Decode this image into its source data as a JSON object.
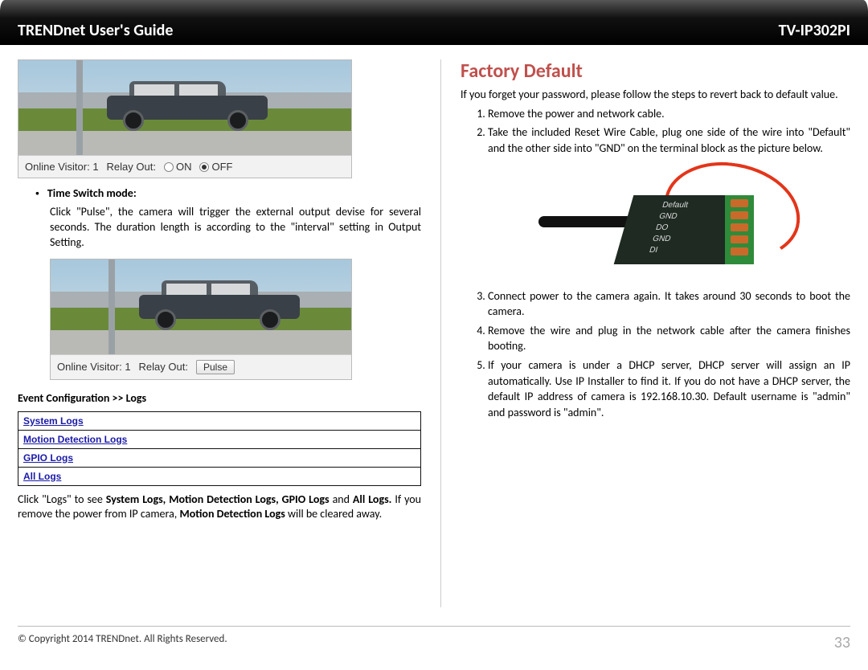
{
  "header": {
    "left": "TRENDnet User's Guide",
    "right": "TV-IP302PI"
  },
  "statusbar": {
    "visitor_label": "Online Visitor:",
    "visitor_count": "1",
    "relay_label": "Relay Out:",
    "on": "ON",
    "off": "OFF",
    "pulse_btn": "Pulse"
  },
  "left": {
    "bullet_title": "Time Switch mode:",
    "bullet_body": "Click \"Pulse\", the camera will trigger the external output devise for several seconds. The duration length is according to the \"interval\" setting in Output Setting.",
    "logs_heading": "Event Configuration >> Logs",
    "logs": [
      "System Logs",
      "Motion Detection Logs",
      "GPIO Logs",
      "All Logs"
    ],
    "logs_para_pre": "Click \"Logs\" to see ",
    "logs_para_bold": "System Logs, Motion Detection Logs, GPIO Logs ",
    "logs_para_mid": "and ",
    "logs_para_bold2": "All Logs. ",
    "logs_para_mid2": "If you remove the power from IP camera, ",
    "logs_para_bold3": "Motion Detection Logs",
    "logs_para_end": " will be cleared away."
  },
  "right": {
    "title": "Factory Default",
    "intro": "If you forget your password, please follow the steps to revert back to default value.",
    "steps": [
      "Remove the power and network cable.",
      "Take the included Reset Wire Cable, plug one side of the wire into \"Default\" and the other side into \"GND\" on the terminal block as the picture below.",
      "Connect power to the camera again. It takes around 30 seconds to boot the camera.",
      "Remove the wire and plug in the network cable after the camera finishes booting.",
      "If your camera is under a DHCP server, DHCP server will assign an IP automatically. Use IP Installer to find it. If you do not have a DHCP server, the default IP address of camera is 192.168.10.30. Default username is \"admin\" and password is \"admin\"."
    ],
    "term_labels": [
      "Default",
      "GND",
      "DO",
      "GND",
      "DI"
    ]
  },
  "footer": {
    "copyright": "© Copyright 2014 TRENDnet.  All Rights Reserved.",
    "page": "33"
  }
}
